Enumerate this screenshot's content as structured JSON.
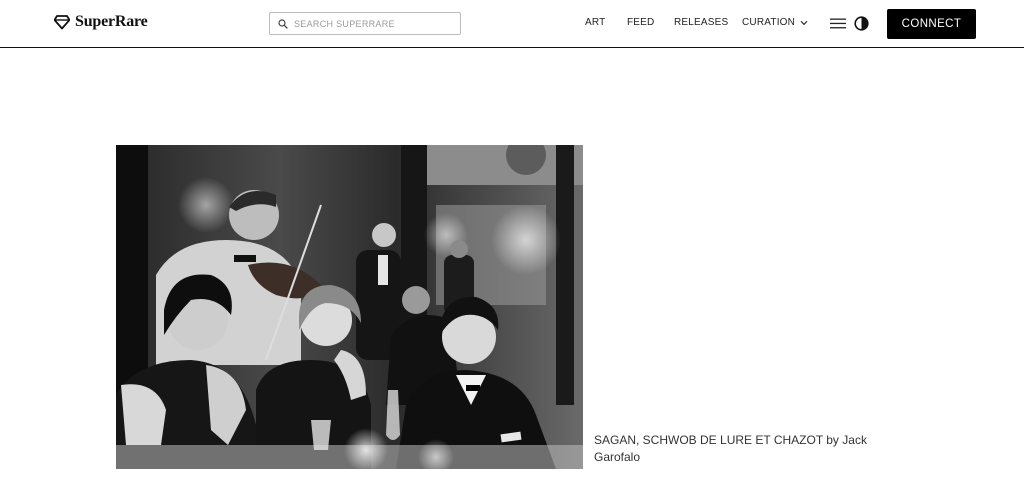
{
  "header": {
    "brand": "SuperRare",
    "search": {
      "placeholder": "SEARCH SUPERRARE",
      "value": ""
    },
    "nav": {
      "art": "ART",
      "feed": "FEED",
      "releases": "RELEASES",
      "curation": "CURATION"
    },
    "icons": {
      "logo": "diamond-logo-icon",
      "search": "search-icon",
      "curation_dropdown": "chevron-down-icon",
      "menu": "hamburger-menu-icon",
      "theme": "contrast-toggle-icon"
    },
    "connect_label": "CONNECT"
  },
  "artwork": {
    "caption": "SAGAN, SCHWOB DE LURE ET CHAZOT by Jack Garofalo",
    "image_description": "black-and-white photograph"
  },
  "colors": {
    "background": "#ffffff",
    "text": "#111111",
    "button_bg": "#000000",
    "button_text": "#ffffff",
    "border": "#111111"
  }
}
